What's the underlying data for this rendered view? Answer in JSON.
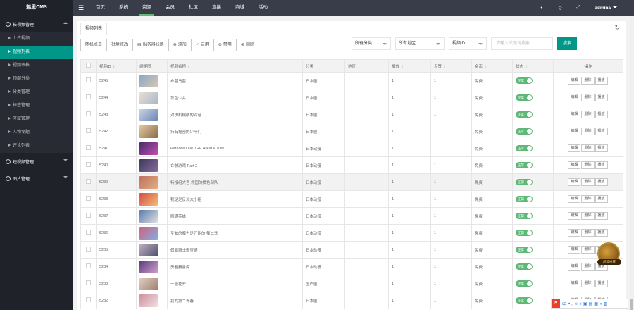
{
  "app": {
    "logo": "魅思CMS"
  },
  "sidebar": {
    "groups": [
      {
        "label": "长视频管理",
        "items": [
          "上传视频",
          "视频列表",
          "视频审核",
          "顶部分类",
          "分类管理",
          "标签管理",
          "区域管理",
          "人物专题",
          "评论列表"
        ]
      },
      {
        "label": "短视频管理"
      },
      {
        "label": "图片管理"
      }
    ],
    "active_item": "视频列表"
  },
  "topnav": {
    "items": [
      "首页",
      "系统",
      "资源",
      "会员",
      "社区",
      "直播",
      "商城",
      "活动"
    ],
    "active": "资源",
    "user": "admina"
  },
  "tab": {
    "label": "视频列表"
  },
  "toolbar": {
    "buttons": [
      "随机点击",
      "批量修改",
      "服务器线路",
      "添加",
      "启用",
      "禁用",
      "删除"
    ]
  },
  "filters": {
    "category": "所有分类",
    "region": "所有地区",
    "field": "视频ID",
    "search_placeholder": "请输入关键词搜索",
    "search_button": "搜索"
  },
  "table": {
    "headers": [
      "视频ID",
      "缩略图",
      "视频名称",
      "分类",
      "地区",
      "播放",
      "点赞",
      "金币",
      "状态",
      "操作"
    ],
    "rows": [
      {
        "id": "5245",
        "name": "布墓乌墓",
        "category": "日本剧",
        "region": "",
        "plays": "1",
        "likes": "1",
        "coins": "免费",
        "status": "正常"
      },
      {
        "id": "5244",
        "name": "灰色少女",
        "category": "日本剧",
        "region": "",
        "plays": "1",
        "likes": "1",
        "coins": "免费",
        "status": "正常"
      },
      {
        "id": "5243",
        "name": "对决机械破的对话",
        "category": "日本剧",
        "region": "",
        "plays": "1",
        "likes": "1",
        "coins": "免费",
        "status": "正常"
      },
      {
        "id": "5242",
        "name": "持有秘密的少年们",
        "category": "日本剧",
        "region": "",
        "plays": "1",
        "likes": "1",
        "coins": "免费",
        "status": "正常"
      },
      {
        "id": "5241",
        "name": "Paradox Live THE ANIMATION",
        "category": "日本动漫",
        "region": "",
        "plays": "1",
        "likes": "1",
        "coins": "免费",
        "status": "正常"
      },
      {
        "id": "5240",
        "name": "亡骸游戏 Part 2",
        "category": "日本动漫",
        "region": "",
        "plays": "1",
        "likes": "1",
        "coins": "免费",
        "status": "正常"
      },
      {
        "id": "5239",
        "name": "特搜组大吾 救国的橘色部队",
        "category": "日本动漫",
        "region": "",
        "plays": "1",
        "likes": "1",
        "coins": "免费",
        "status": "正常"
      },
      {
        "id": "5238",
        "name": "我是是反派大小姐",
        "category": "日本动漫",
        "region": "",
        "plays": "1",
        "likes": "1",
        "coins": "免费",
        "status": "正常"
      },
      {
        "id": "5237",
        "name": "圆满英雄",
        "category": "日本动漫",
        "region": "",
        "plays": "1",
        "likes": "1",
        "coins": "免费",
        "status": "正常"
      },
      {
        "id": "5236",
        "name": "圣女的魔力是万能的 第二季",
        "category": "日本动漫",
        "region": "",
        "plays": "1",
        "likes": "1",
        "coins": "免费",
        "status": "正常"
      },
      {
        "id": "5235",
        "name": "假面骑士歌查德",
        "category": "日本动漫",
        "region": "",
        "plays": "1",
        "likes": "1",
        "coins": "免费",
        "status": "正常"
      },
      {
        "id": "5234",
        "name": "勇者赫鲁库",
        "category": "日本动漫",
        "region": "",
        "plays": "1",
        "likes": "1",
        "coins": "免费",
        "status": "正常"
      },
      {
        "id": "5233",
        "name": "一念花开",
        "category": "国产剧",
        "region": "",
        "plays": "1",
        "likes": "1",
        "coins": "免费",
        "status": "正常"
      },
      {
        "id": "5232",
        "name": "我的第二青春",
        "category": "日本剧",
        "region": "",
        "plays": "1",
        "likes": "1",
        "coins": "免费",
        "status": "正常"
      }
    ],
    "actions": [
      "编辑",
      "删除",
      "播放"
    ]
  },
  "widgets": {
    "float_label": "超级推荐",
    "ime_label": "中"
  },
  "colors": {
    "accent": "#009688",
    "sidebar": "#20222a",
    "topbar": "#393d49",
    "toggle": "#5fb878"
  }
}
